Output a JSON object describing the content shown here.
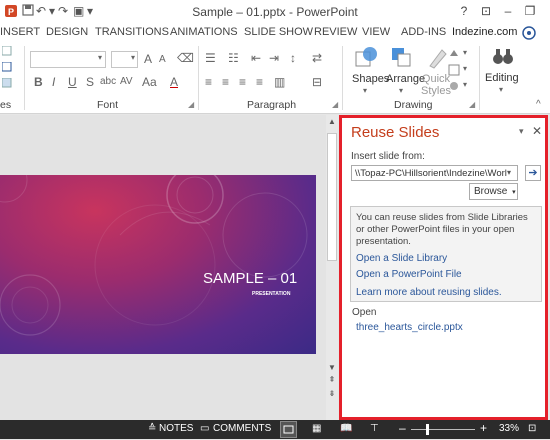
{
  "window": {
    "title": "Sample – 01.pptx - PowerPoint",
    "help": "?",
    "minimize": "–",
    "restore": "❐",
    "close": "✕"
  },
  "tabs": [
    {
      "label": "INSERT"
    },
    {
      "label": "DESIGN"
    },
    {
      "label": "TRANSITIONS"
    },
    {
      "label": "ANIMATIONS"
    },
    {
      "label": "SLIDE SHOW"
    },
    {
      "label": "REVIEW"
    },
    {
      "label": "VIEW"
    },
    {
      "label": "ADD-INS"
    },
    {
      "label": "Indezine.com"
    }
  ],
  "ribbon": {
    "partial_group": "es",
    "font_group": "Font",
    "paragraph_group": "Paragraph",
    "drawing_group": "Drawing",
    "shapes": "Shapes",
    "arrange": "Arrange",
    "quick_styles": "Quick\nStyles",
    "editing": "Editing",
    "font_bold": "B",
    "font_italic": "I",
    "font_underline": "U",
    "font_strike": "S",
    "font_spacing": "AV",
    "font_case": "Aa",
    "font_color": "A",
    "font_grow": "A",
    "font_shrink": "A"
  },
  "slide": {
    "title": "SAMPLE – 01",
    "subtitle": "PRESENTATION"
  },
  "pane": {
    "title": "Reuse Slides",
    "insert_label": "Insert slide from:",
    "path_value": "\\\\Topaz-PC\\Hillsorient\\Indezine\\Worl",
    "browse": "Browse",
    "info": "You can reuse slides from Slide Libraries or other PowerPoint files in your open presentation.",
    "link1": "Open a Slide Library",
    "link2": "Open a PowerPoint File",
    "link3": "Learn more about reusing slides.",
    "open_label": "Open",
    "file": "three_hearts_circle.pptx"
  },
  "status": {
    "notes": "NOTES",
    "comments": "COMMENTS",
    "zoom": "33%",
    "minus": "–",
    "plus": "+"
  },
  "colors": {
    "accent": "#c43e1c",
    "highlight_border": "#e4202a",
    "link": "#2b579a",
    "status_bg": "#2b2b2b"
  }
}
